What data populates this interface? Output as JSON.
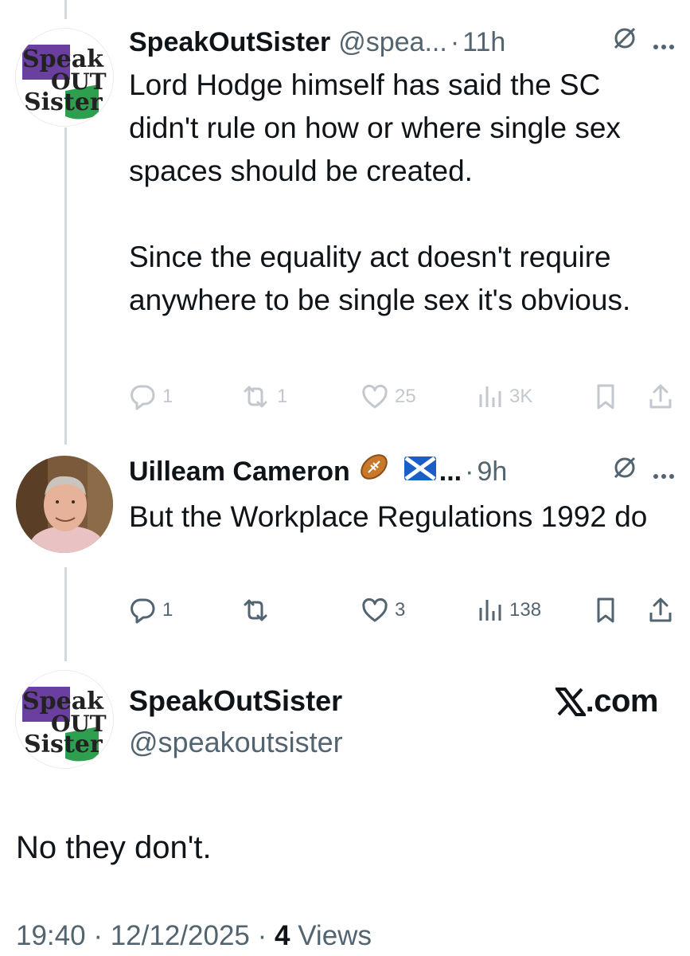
{
  "tweets": [
    {
      "author_name": "SpeakOutSister",
      "author_handle": "@spea...",
      "time": "11h",
      "text_paragraphs": [
        "Lord Hodge himself has said the SC didn't rule on how or where single sex spaces should be created.",
        "Since the equality act doesn't require anywhere to be single sex it's obvious."
      ],
      "stats": {
        "replies": "1",
        "reposts": "1",
        "likes": "25",
        "views": "3K"
      },
      "avatar_text": [
        "Speak",
        "OUT",
        "Sister"
      ]
    },
    {
      "author_name": "Uilleam Cameron",
      "author_handle": "...",
      "time": "9h",
      "text_paragraphs": [
        "But the Workplace Regulations 1992 do"
      ],
      "stats": {
        "replies": "1",
        "reposts": "",
        "likes": "3",
        "views": "138"
      },
      "emojis": [
        "rugby-ball-emoji",
        "scotland-flag-emoji"
      ]
    }
  ],
  "main_tweet": {
    "author_name": "SpeakOutSister",
    "author_handle": "@speakoutsister",
    "text": "No they don't.",
    "time": "19:40",
    "date": "12/12/2025",
    "views_count": "4",
    "views_label": "Views",
    "avatar_text": [
      "Speak",
      "OUT",
      "Sister"
    ]
  },
  "watermark": {
    "domain": ".com"
  },
  "separator": "·",
  "colors": {
    "text": "#0f1419",
    "secondary": "#536471",
    "thread_line": "#cfd9de",
    "avatar_purple": "#6b3fa0",
    "avatar_green": "#2e9e4f"
  }
}
